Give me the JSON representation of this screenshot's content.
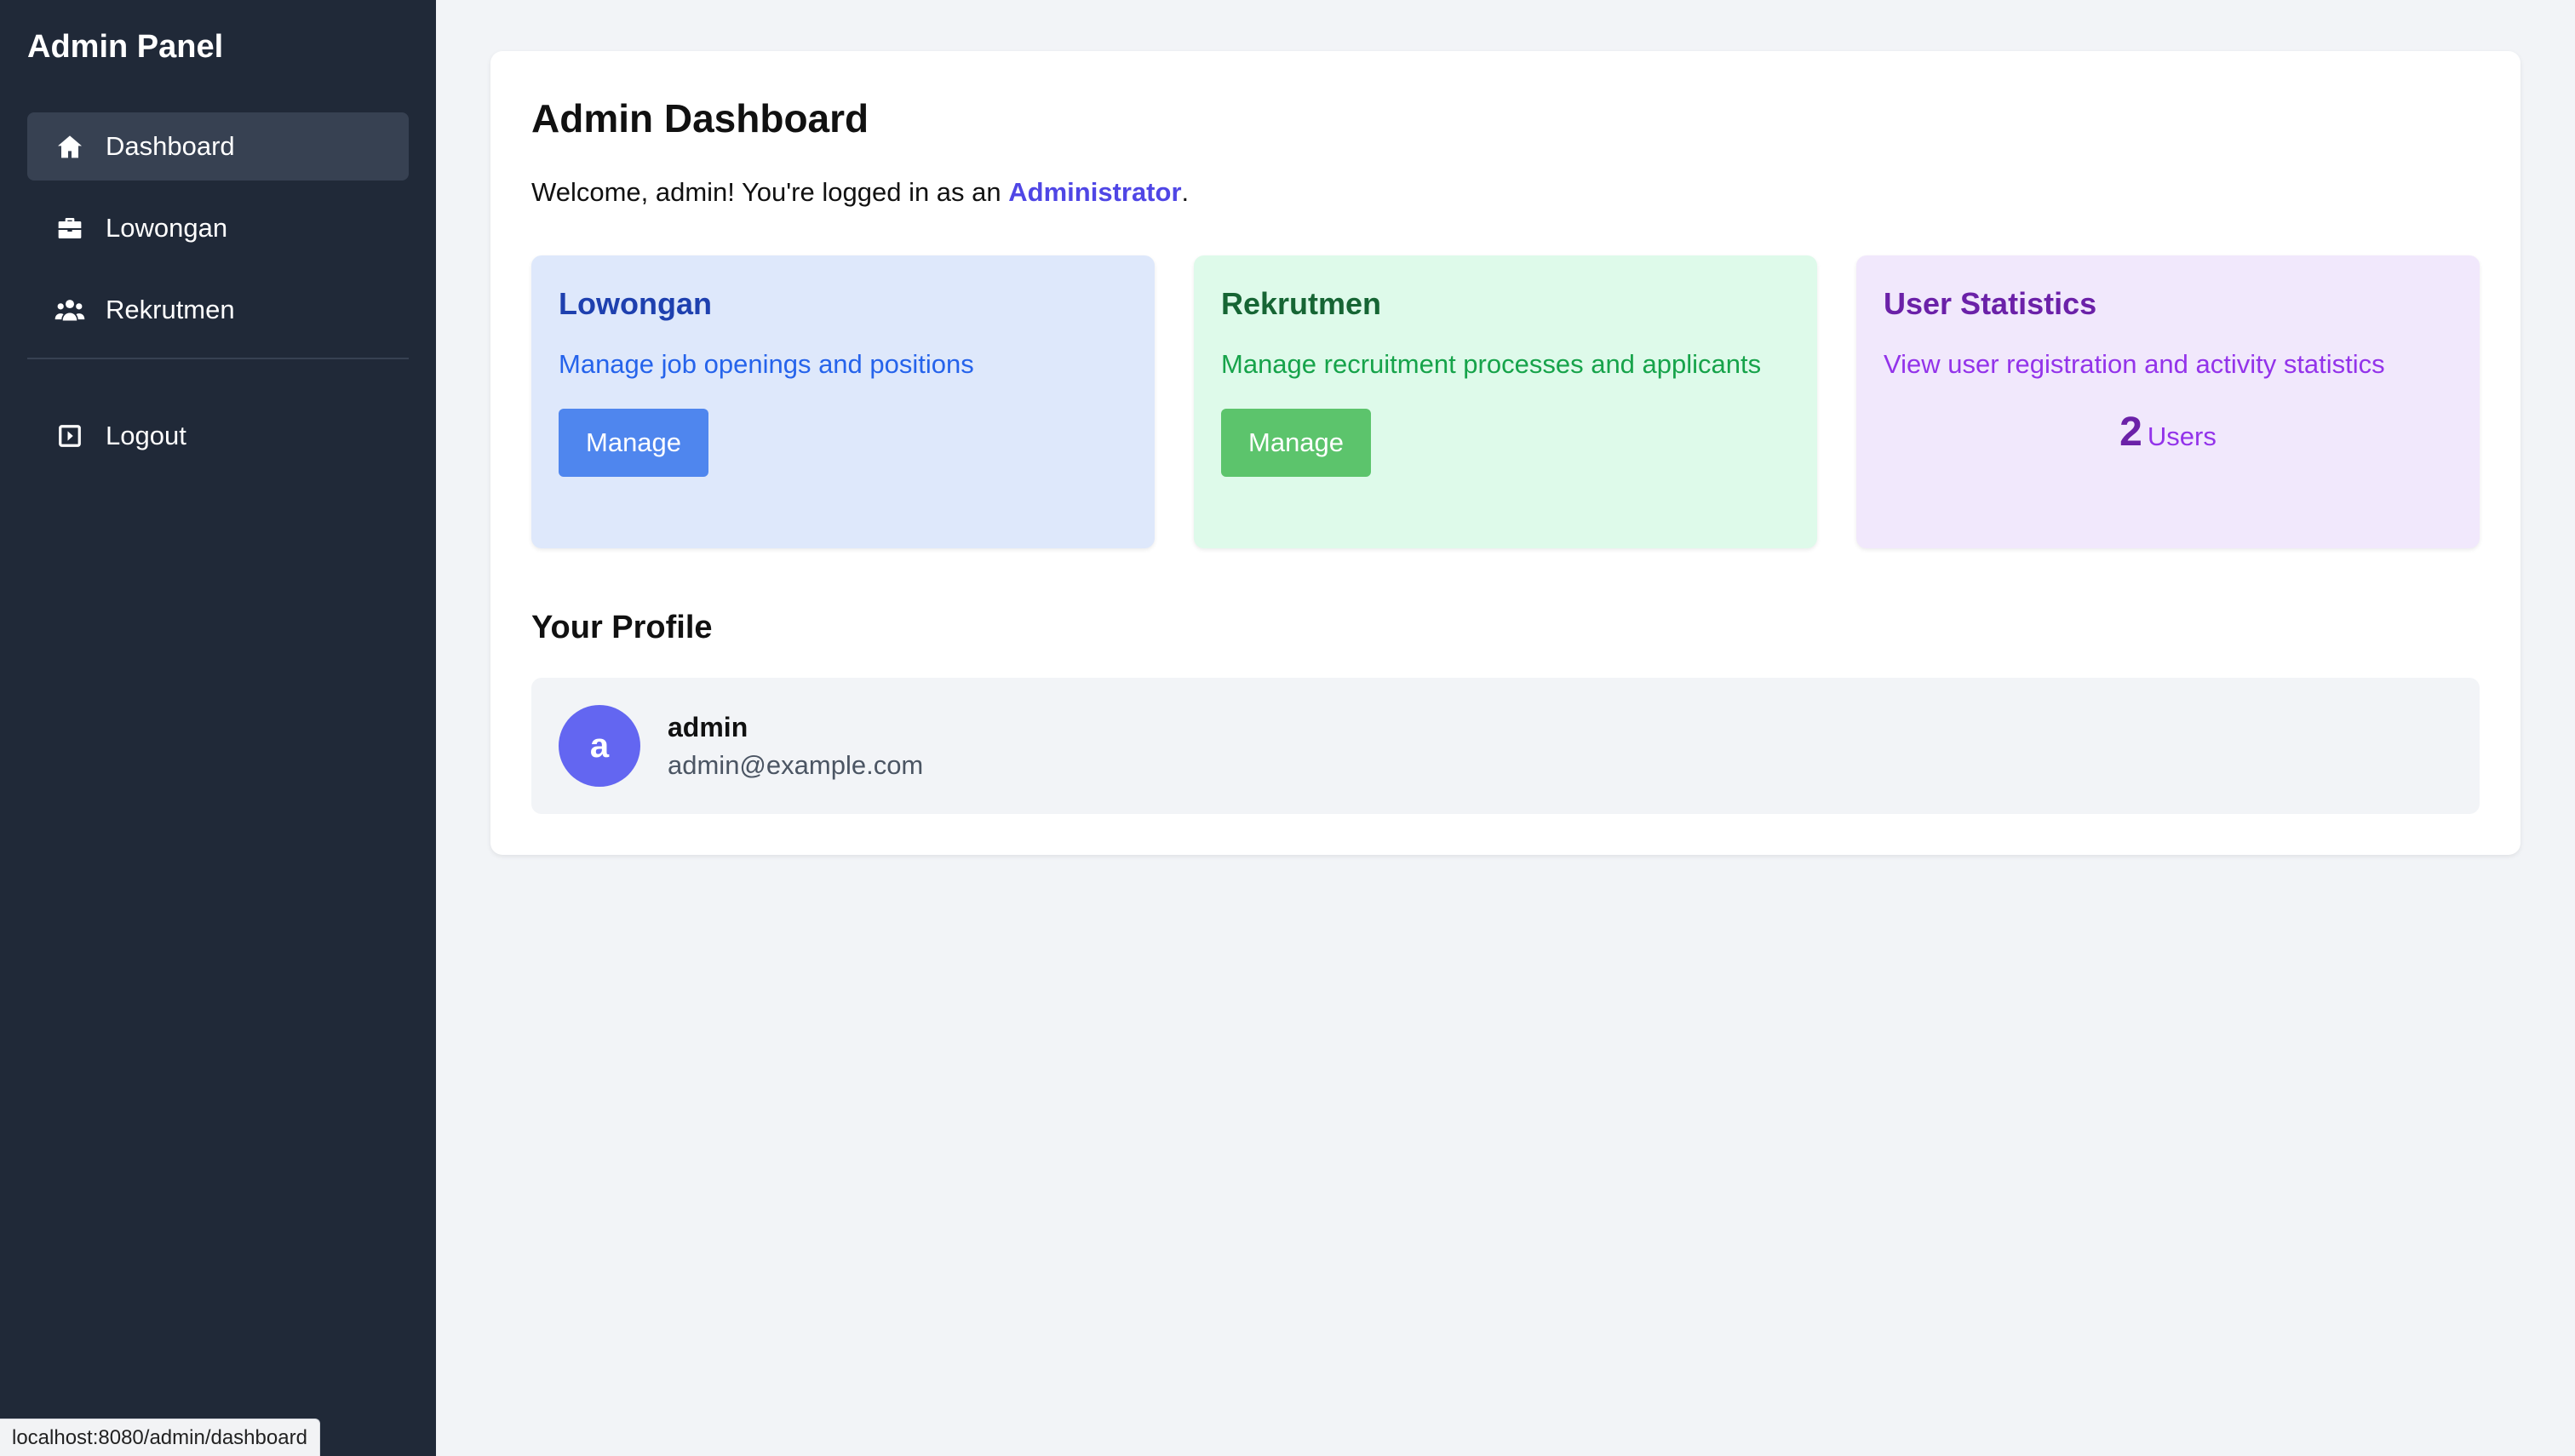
{
  "sidebar": {
    "brand": "Admin Panel",
    "items": [
      {
        "label": "Dashboard",
        "icon": "home-icon",
        "active": true
      },
      {
        "label": "Lowongan",
        "icon": "briefcase-icon",
        "active": false
      },
      {
        "label": "Rekrutmen",
        "icon": "users-icon",
        "active": false
      }
    ],
    "logout": {
      "label": "Logout",
      "icon": "logout-icon"
    }
  },
  "status_bar": {
    "url": "localhost:8080/admin/dashboard"
  },
  "main": {
    "title": "Admin Dashboard",
    "welcome": {
      "prefix": "Welcome, admin! You're logged in as an ",
      "role": "Administrator",
      "suffix": "."
    },
    "tiles": [
      {
        "title": "Lowongan",
        "description": "Manage job openings and positions",
        "button": "Manage",
        "color": "#dee8fb"
      },
      {
        "title": "Rekrutmen",
        "description": "Manage recruitment processes and applicants",
        "button": "Manage",
        "color": "#defaea"
      },
      {
        "title": "User Statistics",
        "description": "View user registration and activity statistics",
        "stat_value": "2",
        "stat_unit": "Users",
        "color": "#f1e8fc"
      }
    ],
    "profile": {
      "section_title": "Your Profile",
      "avatar_initial": "a",
      "name": "admin",
      "email": "admin@example.com"
    }
  },
  "colors": {
    "sidebar_bg": "#202938",
    "accent": "#4f46e5",
    "avatar": "#6366f1"
  }
}
